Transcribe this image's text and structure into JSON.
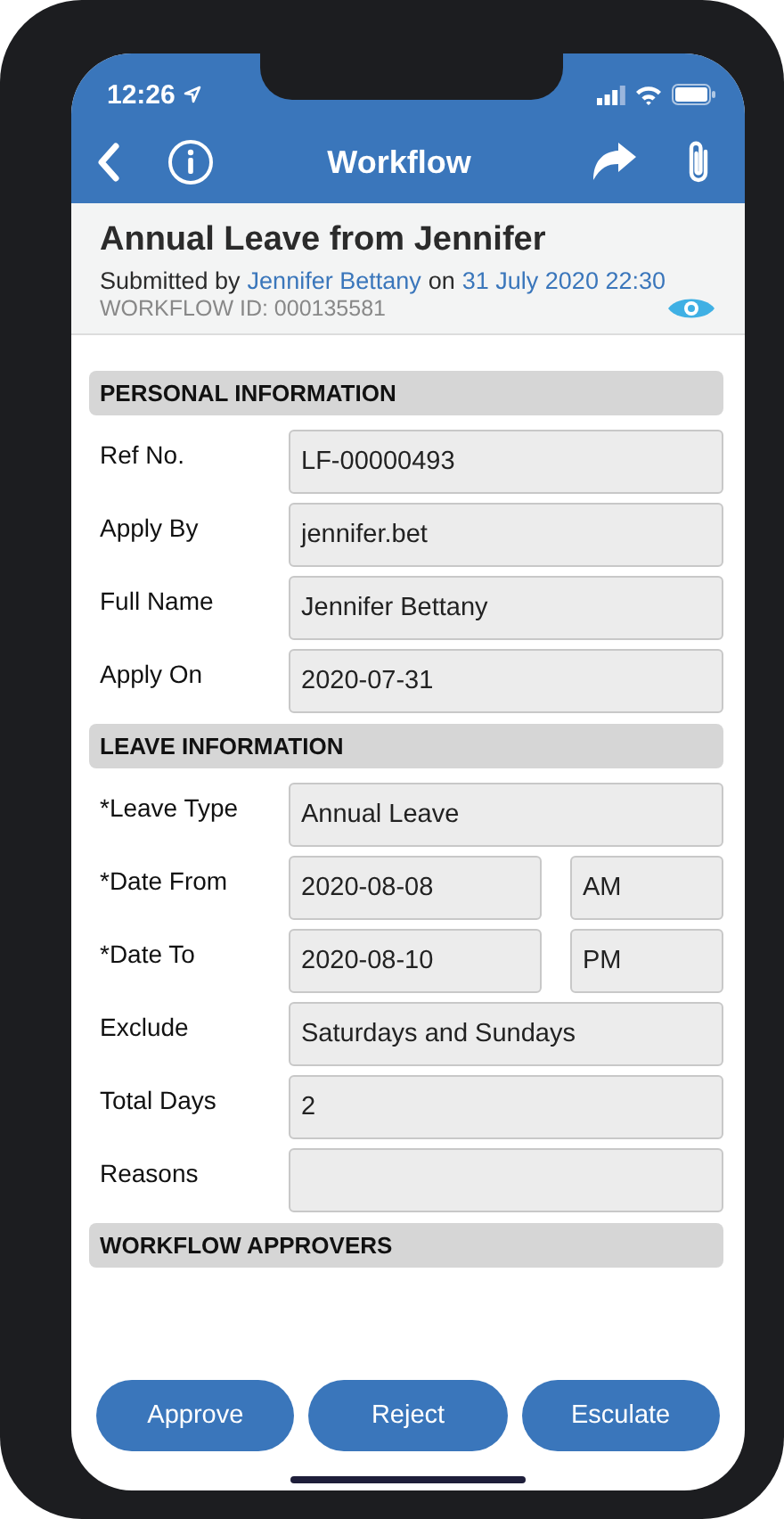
{
  "status_bar": {
    "time": "12:26"
  },
  "nav_bar": {
    "title": "Workflow"
  },
  "header": {
    "title": "Annual Leave from Jennifer",
    "submitted_prefix": "Submitted by",
    "submitter": "Jennifer Bettany",
    "on": "on",
    "submitted_at": "31 July 2020 22:30",
    "workflow_id": "WORKFLOW ID: 000135581"
  },
  "sections": [
    {
      "title": "PERSONAL INFORMATION",
      "rows": [
        {
          "label": "Ref No.",
          "fields": [
            {
              "value": "LF-00000493"
            }
          ]
        },
        {
          "label": "Apply By",
          "fields": [
            {
              "value": "jennifer.bet"
            }
          ]
        },
        {
          "label": "Full Name",
          "fields": [
            {
              "value": "Jennifer Bettany"
            }
          ]
        },
        {
          "label": "Apply On",
          "fields": [
            {
              "value": "2020-07-31"
            }
          ]
        }
      ]
    },
    {
      "title": "LEAVE INFORMATION",
      "rows": [
        {
          "label": "*Leave Type",
          "fields": [
            {
              "value": "Annual Leave"
            }
          ]
        },
        {
          "label": "*Date From",
          "fields": [
            {
              "value": "2020-08-08"
            },
            {
              "value": "AM"
            }
          ]
        },
        {
          "label": "*Date To",
          "fields": [
            {
              "value": "2020-08-10"
            },
            {
              "value": "PM"
            }
          ]
        },
        {
          "label": "Exclude",
          "fields": [
            {
              "value": "Saturdays and Sundays"
            }
          ]
        },
        {
          "label": "Total Days",
          "fields": [
            {
              "value": "2"
            }
          ]
        },
        {
          "label": "Reasons"
        }
      ]
    },
    {
      "title": "WORKFLOW APPROVERS"
    }
  ],
  "buttons": [
    "Approve",
    "Reject",
    "Esculate"
  ]
}
